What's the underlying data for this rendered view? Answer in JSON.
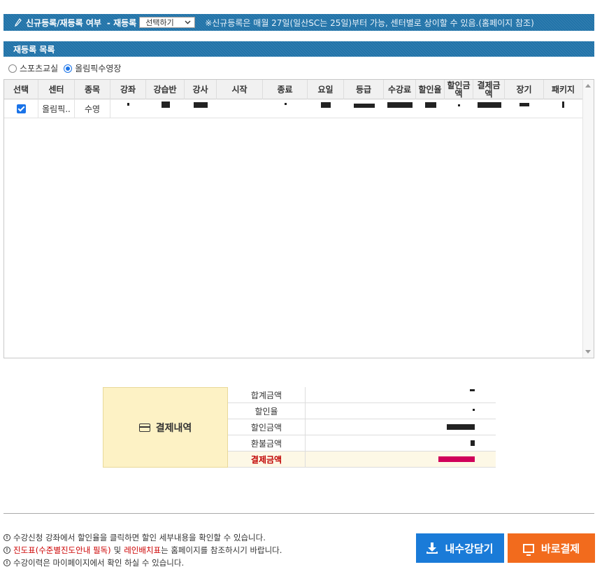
{
  "top": {
    "title": "신규등록/재등록 여부",
    "mode_label": "- 재등록",
    "select_value": "선택하기",
    "notice": "※신규등록은 매월 27일(일산SC는 25일)부터 가능, 센터별로 상이할 수 있음.(홈페이지 참조)"
  },
  "section": {
    "title": "재등록 목록"
  },
  "filter": {
    "options": [
      "스포츠교실",
      "올림픽수영장"
    ],
    "selected": "올림픽수영장"
  },
  "grid": {
    "headers": [
      "선택",
      "센터",
      "종목",
      "강좌",
      "강습반",
      "강사",
      "시작",
      "종료",
      "요일",
      "등급",
      "수강료",
      "할인율",
      "할인금액",
      "결제금액",
      "장기",
      "패키지"
    ],
    "rows": [
      {
        "center": "올림픽..",
        "sport": "수영",
        "checked": true
      }
    ]
  },
  "payment": {
    "title": "결제내역",
    "rows": [
      {
        "label": "합계금액"
      },
      {
        "label": "할인율"
      },
      {
        "label": "할인금액"
      },
      {
        "label": "환불금액"
      },
      {
        "label": "결제금액"
      }
    ]
  },
  "notes": {
    "line1": "수강신청 강좌에서 할인율을 클릭하면 할인 세부내용을 확인할 수 있습니다.",
    "line2_red1": "진도표(수준별진도안내 필독)",
    "line2_mid": "및",
    "line2_red2": "레인배치표",
    "line2_end": "는 홈페이지를 참조하시기 바랍니다.",
    "line3": "수강이력은 마이페이지에서 확인 하실 수 있습니다."
  },
  "buttons": {
    "cart": "내수강담기",
    "pay": "바로결제"
  },
  "colors": {
    "header_bar": "#1f72a8",
    "cart_button": "#1a7bd8",
    "pay_button": "#f26b1d",
    "payment_panel": "#fdf2c5"
  },
  "icons": [
    "pen-icon",
    "chevron-down-icon",
    "credit-card-icon",
    "info-icon",
    "download-icon",
    "monitor-icon"
  ]
}
